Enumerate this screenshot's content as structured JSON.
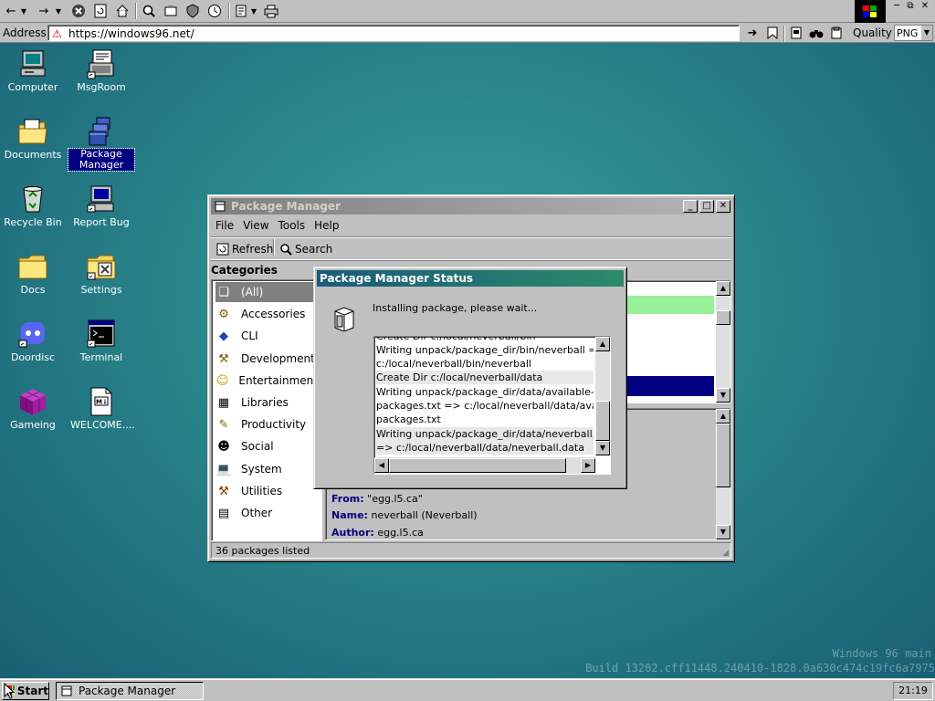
{
  "browser": {
    "address_label": "Address",
    "url": "https://windows96.net/",
    "quality_label": "Quality",
    "format": "PNG"
  },
  "desktop": {
    "icons": [
      {
        "label": "Computer"
      },
      {
        "label": "MsgRoom"
      },
      {
        "label": "Documents"
      },
      {
        "label": "Package Manager"
      },
      {
        "label": "Recycle Bin"
      },
      {
        "label": "Report Bug"
      },
      {
        "label": "Docs"
      },
      {
        "label": "Settings"
      },
      {
        "label": "Doordisc"
      },
      {
        "label": "Terminal"
      },
      {
        "label": "Gameing"
      },
      {
        "label": "WELCOME...."
      }
    ],
    "watermark_line1": "Windows 96 main",
    "watermark_line2": "Build 13202.cff11448.240410-1828.0a630c474c19fc6a7975"
  },
  "package_manager": {
    "title": "Package Manager",
    "menu": [
      "File",
      "View",
      "Tools",
      "Help"
    ],
    "toolbar": {
      "refresh": "Refresh",
      "search": "Search"
    },
    "categories_heading": "Categories",
    "categories": [
      "(All)",
      "Accessories",
      "CLI",
      "Development",
      "Entertainment",
      "Libraries",
      "Productivity",
      "Social",
      "System",
      "Utilities",
      "Other"
    ],
    "details": {
      "from_label": "From:",
      "from_value": "\"egg.l5.ca\"",
      "name_label": "Name:",
      "name_value": "neverball (Neverball)",
      "author_label": "Author:",
      "author_value": "egg.l5.ca"
    },
    "status": "36 packages listed"
  },
  "status_dialog": {
    "title": "Package Manager Status",
    "message": "Installing package, please wait...",
    "log": [
      "Create Dir c:/local/neverball/bin",
      "Writing unpack/package_dir/bin/neverball =>",
      "c:/local/neverball/bin/neverball",
      "Create Dir c:/local/neverball/data",
      "Writing unpack/package_dir/data/available-",
      "packages.txt => c:/local/neverball/data/available-",
      "packages.txt",
      "Writing unpack/package_dir/data/neverball.data",
      "=> c:/local/neverball/data/neverball.data"
    ]
  },
  "taskbar": {
    "start": "Start",
    "task": "Package Manager",
    "clock": "21:19"
  }
}
